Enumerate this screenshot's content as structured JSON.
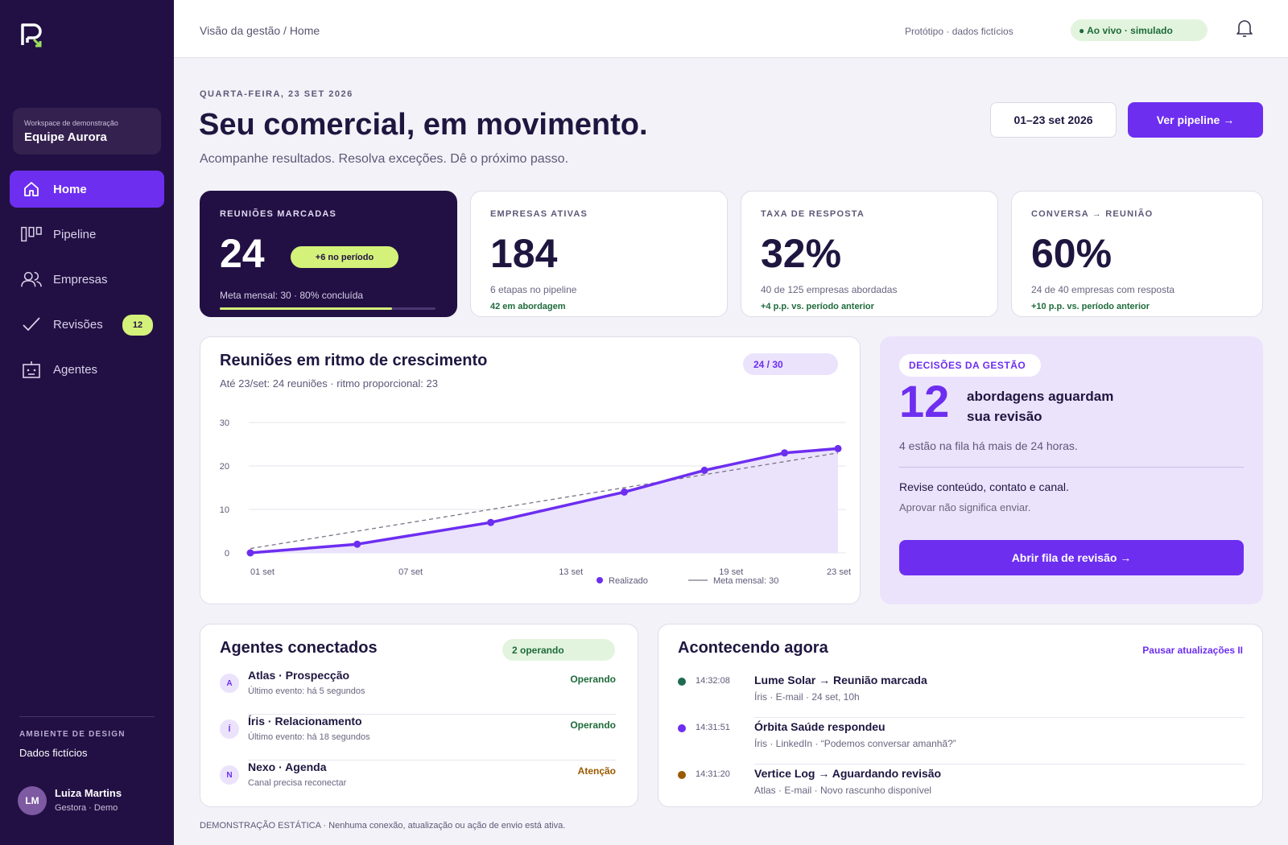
{
  "sidebar": {
    "workspace_label": "Workspace de demonstração",
    "workspace_name": "Equipe Aurora",
    "items": [
      {
        "label": "Home",
        "icon": "home-icon",
        "active": true
      },
      {
        "label": "Pipeline",
        "icon": "pipeline-icon"
      },
      {
        "label": "Empresas",
        "icon": "users-icon"
      },
      {
        "label": "Revisões",
        "icon": "check-icon",
        "badge": "12"
      },
      {
        "label": "Agentes",
        "icon": "robot-icon"
      }
    ],
    "env_label": "AMBIENTE DE DESIGN",
    "env_value": "Dados fictícios",
    "user": {
      "initials": "LM",
      "name": "Luiza Martins",
      "role": "Gestora · Demo"
    }
  },
  "topbar": {
    "breadcrumb": "Visão da gestão / Home",
    "proto_note": "Protótipo · dados fictícios",
    "live_status": "● Ao vivo · simulado"
  },
  "header": {
    "date": "QUARTA-FEIRA, 23 SET 2026",
    "title": "Seu comercial, em movimento.",
    "subtitle": "Acompanhe resultados. Resolva exceções. Dê o próximo passo.",
    "date_range": "01–23 set 2026",
    "cta": "Ver pipeline →"
  },
  "kpis": [
    {
      "label": "REUNIÕES MARCADAS",
      "value": "24",
      "pill": "+6 no período",
      "meta": "Meta mensal: 30 · 80% concluída",
      "progress": 0.8
    },
    {
      "label": "EMPRESAS ATIVAS",
      "value": "184",
      "note": "6 etapas no pipeline",
      "delta": "42 em abordagem"
    },
    {
      "label": "TAXA DE RESPOSTA",
      "value": "32%",
      "note": "40 de 125 empresas abordadas",
      "delta": "+4 p.p. vs. período anterior"
    },
    {
      "label": "CONVERSA → REUNIÃO",
      "value": "60%",
      "note": "24 de 40 empresas com resposta",
      "delta": "+10 p.p. vs. período anterior"
    }
  ],
  "chart": {
    "title": "Reuniões em ritmo de crescimento",
    "subtitle": "Até 23/set: 24 reuniões · ritmo proporcional: 23",
    "pill": "24 / 30",
    "legend_actual": "Realizado",
    "legend_target": "Meta mensal: 30"
  },
  "chart_data": {
    "type": "line",
    "x_ticks": [
      "01 set",
      "07 set",
      "13 set",
      "19 set",
      "23 set"
    ],
    "y_ticks": [
      "0",
      "10",
      "20",
      "30"
    ],
    "ylim": [
      0,
      30
    ],
    "xlim": [
      1,
      23
    ],
    "grid": true,
    "legend_position": "bottom-right",
    "series": [
      {
        "name": "Realizado",
        "style": "solid-area",
        "color": "#6d2ef0",
        "points": [
          [
            1,
            0
          ],
          [
            5,
            2
          ],
          [
            10,
            7
          ],
          [
            15,
            14
          ],
          [
            18,
            19
          ],
          [
            21,
            23
          ],
          [
            23,
            24
          ]
        ]
      },
      {
        "name": "Meta mensal: 30",
        "style": "dashed",
        "color": "#7a7488",
        "points": [
          [
            1,
            1
          ],
          [
            23,
            23
          ]
        ]
      }
    ]
  },
  "decision": {
    "tag": "DECISÕES DA GESTÃO",
    "count": "12",
    "text": "abordagens aguardam sua revisão",
    "note": "4 estão na fila há mais de 24 horas.",
    "review": "Revise conteúdo, contato e canal.",
    "hint": "Aprovar não significa enviar.",
    "cta": "Abrir fila de revisão →"
  },
  "agents": {
    "title": "Agentes conectados",
    "pill": "2 operando",
    "items": [
      {
        "initial": "A",
        "name": "Atlas · Prospecção",
        "sub": "Último evento: há 5 segundos",
        "status": "Operando"
      },
      {
        "initial": "Í",
        "name": "Íris · Relacionamento",
        "sub": "Último evento: há 18 segundos",
        "status": "Operando"
      },
      {
        "initial": "N",
        "name": "Nexo · Agenda",
        "sub": "Canal precisa reconectar",
        "status": "Atenção"
      }
    ]
  },
  "activity": {
    "title": "Acontecendo agora",
    "pause": "Pausar atualizações II",
    "items": [
      {
        "time": "14:32:08",
        "title": "Lume Solar → Reunião marcada",
        "sub": "Íris · E-mail · 24 set, 10h",
        "color": "#1e6b4f"
      },
      {
        "time": "14:31:51",
        "title": "Órbita Saúde respondeu",
        "sub": "Íris · LinkedIn · “Podemos conversar amanhã?”",
        "color": "#6d2ef0"
      },
      {
        "time": "14:31:20",
        "title": "Vertice Log → Aguardando revisão",
        "sub": "Atlas · E-mail · Novo rascunho disponível",
        "color": "#9a5a00"
      }
    ]
  },
  "footer": "DEMONSTRAÇÃO ESTÁTICA · Nenhuma conexão, atualização ou ação de envio está ativa."
}
